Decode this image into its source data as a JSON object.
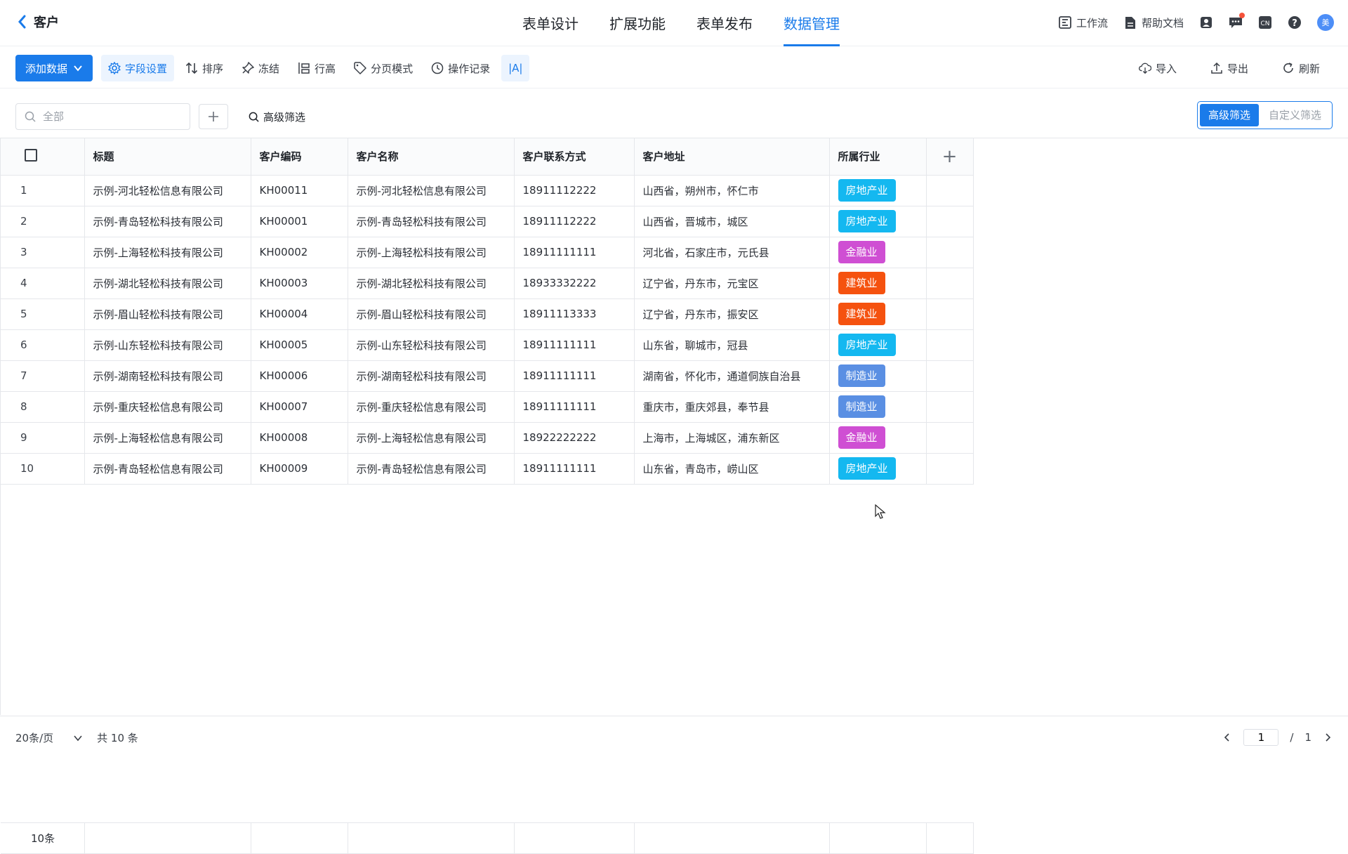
{
  "app": {
    "back_label": "客户"
  },
  "nav": {
    "tabs": [
      "表单设计",
      "扩展功能",
      "表单发布",
      "数据管理"
    ],
    "active_index": 3
  },
  "topright": {
    "workflow": "工作流",
    "help_docs": "帮助文档",
    "lang": "CN",
    "avatar": "美"
  },
  "toolbar": {
    "add_data": "添加数据",
    "field_settings": "字段设置",
    "sort": "排序",
    "freeze": "冻结",
    "row_height": "行高",
    "page_mode": "分页模式",
    "op_log": "操作记录",
    "text_mode": "|A|",
    "import": "导入",
    "export": "导出",
    "refresh": "刷新"
  },
  "filter": {
    "search_placeholder": "全部",
    "advanced": "高级筛选",
    "seg_advanced": "高级筛选",
    "seg_custom": "自定义筛选"
  },
  "table": {
    "columns": [
      "标题",
      "客户编码",
      "客户名称",
      "客户联系方式",
      "客户地址",
      "所属行业"
    ],
    "rows": [
      {
        "no": "1",
        "title": "示例-河北轻松信息有限公司",
        "code": "KH00011",
        "name": "示例-河北轻松信息有限公司",
        "phone": "18911112222",
        "addr": "山西省，朔州市，怀仁市",
        "industry": "房地产业",
        "color": "#14b8f0"
      },
      {
        "no": "2",
        "title": "示例-青岛轻松科技有限公司",
        "code": "KH00001",
        "name": "示例-青岛轻松科技有限公司",
        "phone": "18911112222",
        "addr": "山西省，晋城市，城区",
        "industry": "房地产业",
        "color": "#14b8f0"
      },
      {
        "no": "3",
        "title": "示例-上海轻松科技有限公司",
        "code": "KH00002",
        "name": "示例-上海轻松科技有限公司",
        "phone": "18911111111",
        "addr": "河北省，石家庄市，元氏县",
        "industry": "金融业",
        "color": "#cf4fd3"
      },
      {
        "no": "4",
        "title": "示例-湖北轻松科技有限公司",
        "code": "KH00003",
        "name": "示例-湖北轻松科技有限公司",
        "phone": "18933332222",
        "addr": "辽宁省，丹东市，元宝区",
        "industry": "建筑业",
        "color": "#f5520f"
      },
      {
        "no": "5",
        "title": "示例-眉山轻松科技有限公司",
        "code": "KH00004",
        "name": "示例-眉山轻松科技有限公司",
        "phone": "18911113333",
        "addr": "辽宁省，丹东市，振安区",
        "industry": "建筑业",
        "color": "#f5520f"
      },
      {
        "no": "6",
        "title": "示例-山东轻松科技有限公司",
        "code": "KH00005",
        "name": "示例-山东轻松科技有限公司",
        "phone": "18911111111",
        "addr": "山东省，聊城市，冠县",
        "industry": "房地产业",
        "color": "#14b8f0"
      },
      {
        "no": "7",
        "title": "示例-湖南轻松科技有限公司",
        "code": "KH00006",
        "name": "示例-湖南轻松科技有限公司",
        "phone": "18911111111",
        "addr": "湖南省，怀化市，通道侗族自治县",
        "industry": "制造业",
        "color": "#5a8fe3"
      },
      {
        "no": "8",
        "title": "示例-重庆轻松信息有限公司",
        "code": "KH00007",
        "name": "示例-重庆轻松信息有限公司",
        "phone": "18911111111",
        "addr": "重庆市，重庆郊县，奉节县",
        "industry": "制造业",
        "color": "#5a8fe3"
      },
      {
        "no": "9",
        "title": "示例-上海轻松信息有限公司",
        "code": "KH00008",
        "name": "示例-上海轻松信息有限公司",
        "phone": "18922222222",
        "addr": "上海市，上海城区，浦东新区",
        "industry": "金融业",
        "color": "#cf4fd3"
      },
      {
        "no": "10",
        "title": "示例-青岛轻松信息有限公司",
        "code": "KH00009",
        "name": "示例-青岛轻松信息有限公司",
        "phone": "18911111111",
        "addr": "山东省，青岛市，崂山区",
        "industry": "房地产业",
        "color": "#14b8f0"
      }
    ],
    "summary_count": "10条"
  },
  "pager": {
    "page_size": "20条/页",
    "total": "共 10 条",
    "current_page": "1",
    "separator": "/",
    "total_pages": "1"
  }
}
